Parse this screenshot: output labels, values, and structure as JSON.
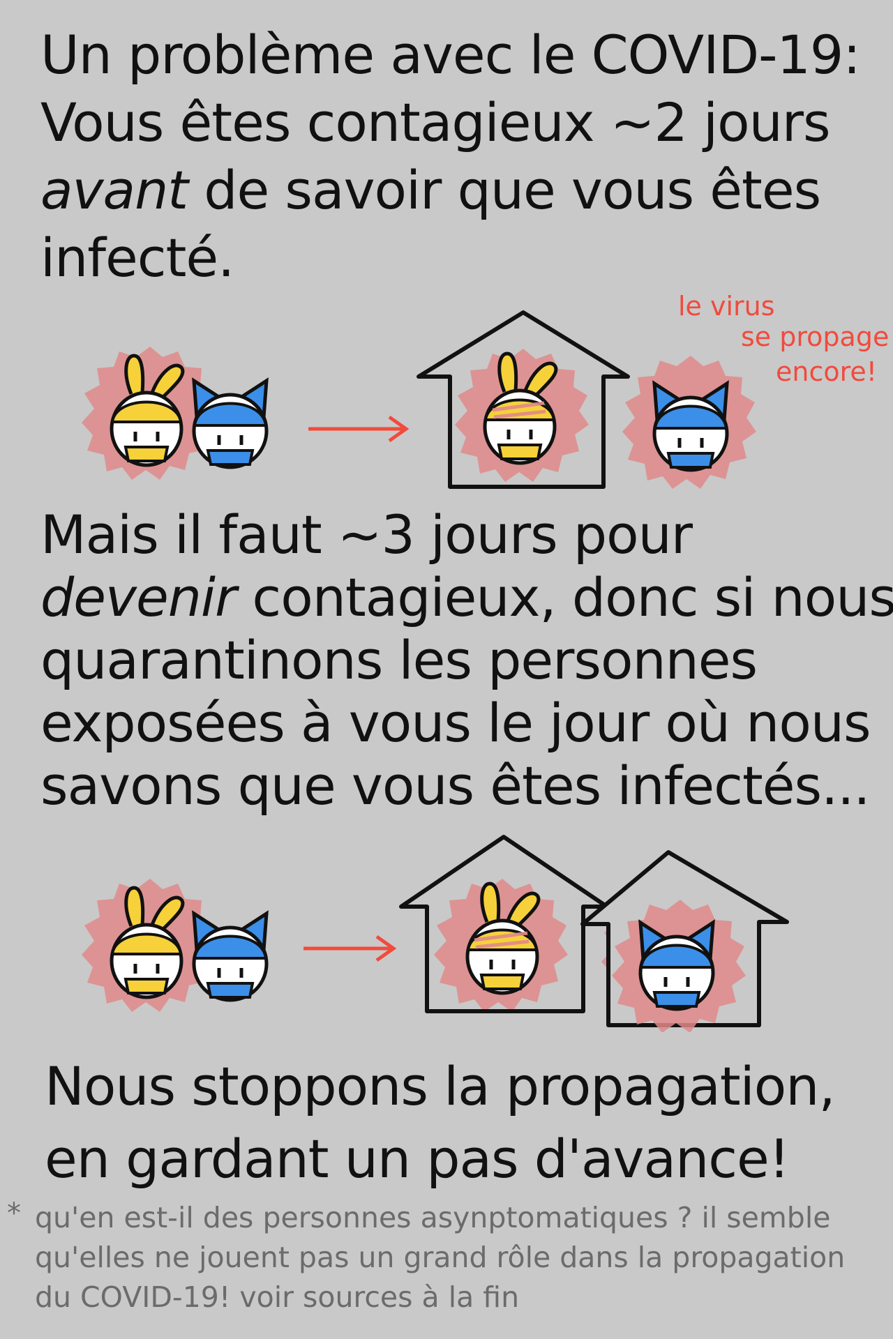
{
  "intro": {
    "line1": "Un problème avec le COVID-19:",
    "line2": "Vous êtes contagieux ~2 jours",
    "line3_em": "avant",
    "line3_rest": " de savoir que vous êtes",
    "line4": "infecté."
  },
  "note": {
    "line1": "le virus",
    "line2": "se propage",
    "line3": "encore!"
  },
  "middle": {
    "line1": "Mais il faut ~3 jours pour",
    "line2_em": "devenir",
    "line2_rest": " contagieux, donc si nous",
    "line3": "quarantinons les personnes",
    "line4": "exposées à vous le jour où nous",
    "line5": "savons que vous êtes infectés..."
  },
  "conclusion": {
    "line1": "Nous stoppons la propagation,",
    "line2": "en gardant un pas d'avance!"
  },
  "footnote": {
    "star": "*",
    "line1": "qu'en est-il des personnes asynptomatiques ? il semble",
    "line2": "qu'elles ne jouent pas un grand rôle dans la propagation",
    "line3": "du COVID-19! voir sources à la fin"
  },
  "colors": {
    "background": "#c9c9c9",
    "glow": "#e08a8a",
    "yellow": "#f6d13a",
    "blue": "#3b8fe8",
    "arrow": "#f24a3c"
  },
  "icons": [
    "yellow-bunny-character-icon",
    "blue-cat-character-icon",
    "house-icon",
    "arrow-icon"
  ]
}
